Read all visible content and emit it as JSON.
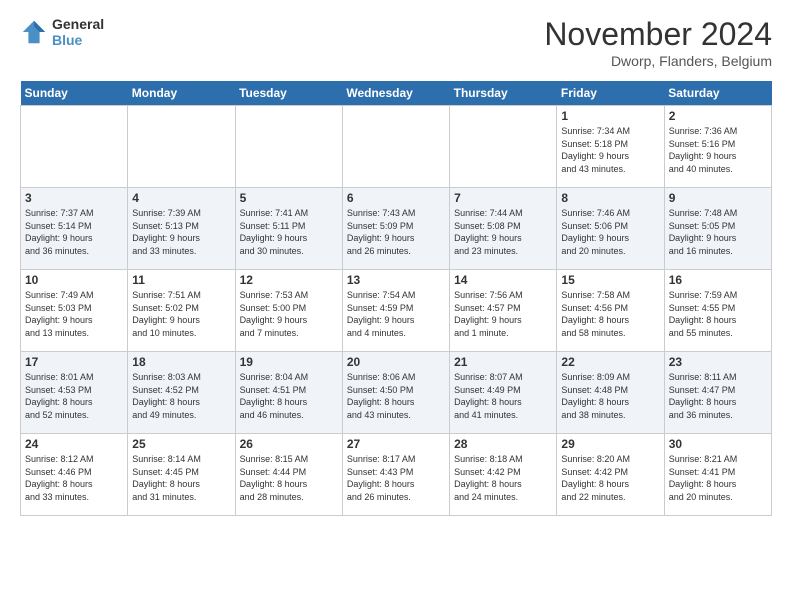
{
  "header": {
    "logo_line1": "General",
    "logo_line2": "Blue",
    "month_title": "November 2024",
    "location": "Dworp, Flanders, Belgium"
  },
  "days_of_week": [
    "Sunday",
    "Monday",
    "Tuesday",
    "Wednesday",
    "Thursday",
    "Friday",
    "Saturday"
  ],
  "weeks": [
    [
      {
        "day": "",
        "info": ""
      },
      {
        "day": "",
        "info": ""
      },
      {
        "day": "",
        "info": ""
      },
      {
        "day": "",
        "info": ""
      },
      {
        "day": "",
        "info": ""
      },
      {
        "day": "1",
        "info": "Sunrise: 7:34 AM\nSunset: 5:18 PM\nDaylight: 9 hours\nand 43 minutes."
      },
      {
        "day": "2",
        "info": "Sunrise: 7:36 AM\nSunset: 5:16 PM\nDaylight: 9 hours\nand 40 minutes."
      }
    ],
    [
      {
        "day": "3",
        "info": "Sunrise: 7:37 AM\nSunset: 5:14 PM\nDaylight: 9 hours\nand 36 minutes."
      },
      {
        "day": "4",
        "info": "Sunrise: 7:39 AM\nSunset: 5:13 PM\nDaylight: 9 hours\nand 33 minutes."
      },
      {
        "day": "5",
        "info": "Sunrise: 7:41 AM\nSunset: 5:11 PM\nDaylight: 9 hours\nand 30 minutes."
      },
      {
        "day": "6",
        "info": "Sunrise: 7:43 AM\nSunset: 5:09 PM\nDaylight: 9 hours\nand 26 minutes."
      },
      {
        "day": "7",
        "info": "Sunrise: 7:44 AM\nSunset: 5:08 PM\nDaylight: 9 hours\nand 23 minutes."
      },
      {
        "day": "8",
        "info": "Sunrise: 7:46 AM\nSunset: 5:06 PM\nDaylight: 9 hours\nand 20 minutes."
      },
      {
        "day": "9",
        "info": "Sunrise: 7:48 AM\nSunset: 5:05 PM\nDaylight: 9 hours\nand 16 minutes."
      }
    ],
    [
      {
        "day": "10",
        "info": "Sunrise: 7:49 AM\nSunset: 5:03 PM\nDaylight: 9 hours\nand 13 minutes."
      },
      {
        "day": "11",
        "info": "Sunrise: 7:51 AM\nSunset: 5:02 PM\nDaylight: 9 hours\nand 10 minutes."
      },
      {
        "day": "12",
        "info": "Sunrise: 7:53 AM\nSunset: 5:00 PM\nDaylight: 9 hours\nand 7 minutes."
      },
      {
        "day": "13",
        "info": "Sunrise: 7:54 AM\nSunset: 4:59 PM\nDaylight: 9 hours\nand 4 minutes."
      },
      {
        "day": "14",
        "info": "Sunrise: 7:56 AM\nSunset: 4:57 PM\nDaylight: 9 hours\nand 1 minute."
      },
      {
        "day": "15",
        "info": "Sunrise: 7:58 AM\nSunset: 4:56 PM\nDaylight: 8 hours\nand 58 minutes."
      },
      {
        "day": "16",
        "info": "Sunrise: 7:59 AM\nSunset: 4:55 PM\nDaylight: 8 hours\nand 55 minutes."
      }
    ],
    [
      {
        "day": "17",
        "info": "Sunrise: 8:01 AM\nSunset: 4:53 PM\nDaylight: 8 hours\nand 52 minutes."
      },
      {
        "day": "18",
        "info": "Sunrise: 8:03 AM\nSunset: 4:52 PM\nDaylight: 8 hours\nand 49 minutes."
      },
      {
        "day": "19",
        "info": "Sunrise: 8:04 AM\nSunset: 4:51 PM\nDaylight: 8 hours\nand 46 minutes."
      },
      {
        "day": "20",
        "info": "Sunrise: 8:06 AM\nSunset: 4:50 PM\nDaylight: 8 hours\nand 43 minutes."
      },
      {
        "day": "21",
        "info": "Sunrise: 8:07 AM\nSunset: 4:49 PM\nDaylight: 8 hours\nand 41 minutes."
      },
      {
        "day": "22",
        "info": "Sunrise: 8:09 AM\nSunset: 4:48 PM\nDaylight: 8 hours\nand 38 minutes."
      },
      {
        "day": "23",
        "info": "Sunrise: 8:11 AM\nSunset: 4:47 PM\nDaylight: 8 hours\nand 36 minutes."
      }
    ],
    [
      {
        "day": "24",
        "info": "Sunrise: 8:12 AM\nSunset: 4:46 PM\nDaylight: 8 hours\nand 33 minutes."
      },
      {
        "day": "25",
        "info": "Sunrise: 8:14 AM\nSunset: 4:45 PM\nDaylight: 8 hours\nand 31 minutes."
      },
      {
        "day": "26",
        "info": "Sunrise: 8:15 AM\nSunset: 4:44 PM\nDaylight: 8 hours\nand 28 minutes."
      },
      {
        "day": "27",
        "info": "Sunrise: 8:17 AM\nSunset: 4:43 PM\nDaylight: 8 hours\nand 26 minutes."
      },
      {
        "day": "28",
        "info": "Sunrise: 8:18 AM\nSunset: 4:42 PM\nDaylight: 8 hours\nand 24 minutes."
      },
      {
        "day": "29",
        "info": "Sunrise: 8:20 AM\nSunset: 4:42 PM\nDaylight: 8 hours\nand 22 minutes."
      },
      {
        "day": "30",
        "info": "Sunrise: 8:21 AM\nSunset: 4:41 PM\nDaylight: 8 hours\nand 20 minutes."
      }
    ]
  ]
}
